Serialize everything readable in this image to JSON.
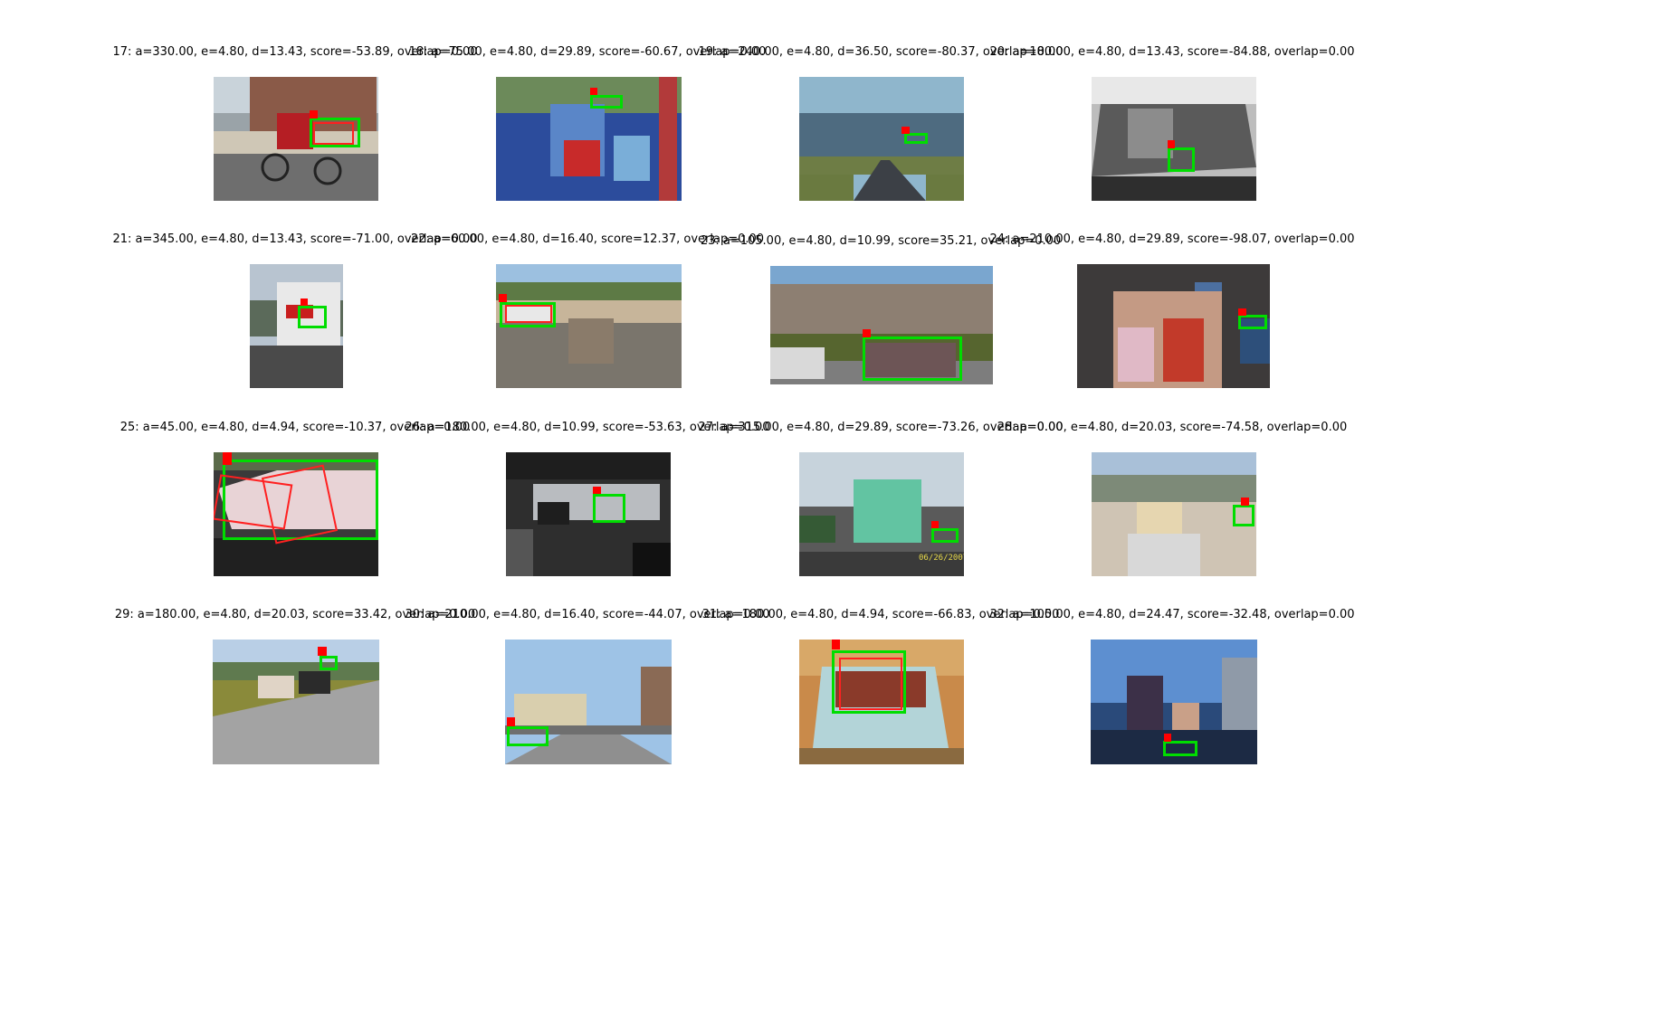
{
  "figure": {
    "panels": [
      {
        "caption": "17: a=330.00, e=4.80, d=13.43, score=-53.89, overlap=0.00",
        "scene": "tandem-bicycle-street"
      },
      {
        "caption": "18: a=75.00, e=4.80, d=29.89, score=-60.67, overlap=0.00",
        "scene": "playground-family"
      },
      {
        "caption": "19: a=240.00, e=4.80, d=36.50, score=-80.37, overlap=0.00",
        "scene": "highway-sky"
      },
      {
        "caption": "20: a=180.00, e=4.80, d=13.43, score=-84.88, overlap=0.00",
        "scene": "car-window-bw"
      },
      {
        "caption": "21: a=345.00, e=4.80, d=13.43, score=-71.00, overlap=0.00",
        "scene": "storefront"
      },
      {
        "caption": "22: a=60.00, e=4.80, d=16.40, score=12.37, overlap=0.00",
        "scene": "horse-rider-village"
      },
      {
        "caption": "23: a=105.00, e=4.80, d=10.99, score=35.21, overlap=0.00",
        "scene": "city-parked-car"
      },
      {
        "caption": "24: a=210.00, e=4.80, d=29.89, score=-98.07, overlap=0.00",
        "scene": "family-indoor"
      },
      {
        "caption": "25: a=45.00, e=4.80, d=4.94, score=-10.37, overlap=0.00",
        "scene": "pink-cadillac"
      },
      {
        "caption": "26: a=180.00, e=4.80, d=10.99, score=-53.63, overlap=0.00",
        "scene": "parking-garage"
      },
      {
        "caption": "27: a=315.00, e=4.80, d=29.89, score=-73.26, overlap=0.00",
        "scene": "green-bus"
      },
      {
        "caption": "28: a=0.00, e=4.80, d=20.03, score=-74.58, overlap=0.00",
        "scene": "scooter-hillside"
      },
      {
        "caption": "29: a=180.00, e=4.80, d=20.03, score=33.42, overlap=0.00",
        "scene": "cattle-roadside"
      },
      {
        "caption": "30: a=210.00, e=4.80, d=16.40, score=-44.07, overlap=0.00",
        "scene": "palm-street"
      },
      {
        "caption": "31: a=180.00, e=4.80, d=4.94, score=-66.83, overlap=0.00",
        "scene": "sports-car-rear"
      },
      {
        "caption": "32: a=105.00, e=4.80, d=24.47, score=-32.48, overlap=0.00",
        "scene": "dusk-city"
      }
    ],
    "colors": {
      "detection_box": "#00dd00",
      "pose_marker": "#ff0000"
    },
    "overlay_stamp": "06/26/2007"
  }
}
